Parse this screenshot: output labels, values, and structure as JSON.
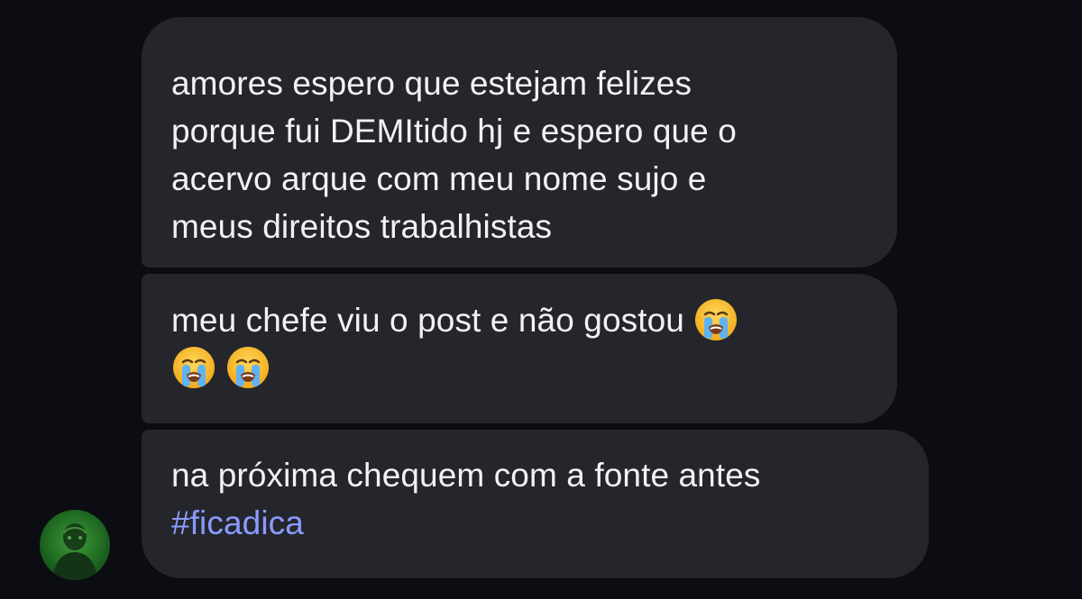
{
  "messages": [
    {
      "lines": [
        "amores espero que estejam felizes",
        "porque fui DEMItido hj e espero que o",
        "acervo arque com meu nome sujo e",
        "meus direitos trabalhistas"
      ]
    },
    {
      "line1": "meu chefe viu o post e não gostou",
      "emojis": [
        "loudly-crying-face-emoji",
        "loudly-crying-face-emoji",
        "loudly-crying-face-emoji"
      ]
    },
    {
      "line1": "na próxima chequem com a fonte antes",
      "hashtag": "#ficadica"
    }
  ],
  "colors": {
    "background": "#0b0d12",
    "bubble": "#25262b",
    "text": "#f2f2f2",
    "hashtag": "#8a9bff"
  },
  "sender": {
    "avatar": "avatar-photo"
  }
}
